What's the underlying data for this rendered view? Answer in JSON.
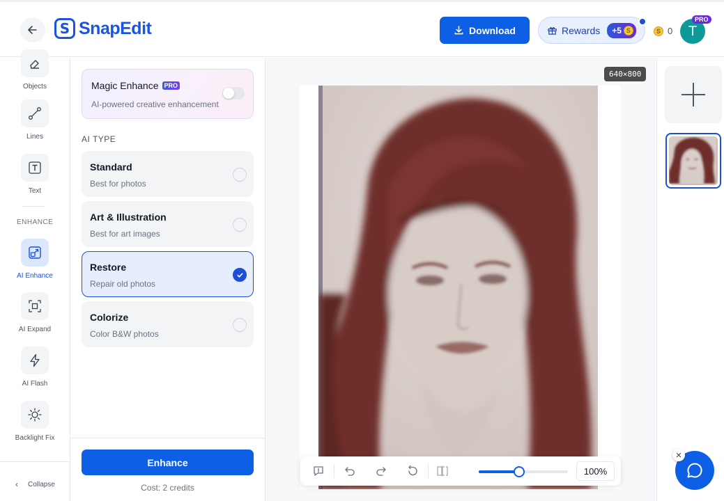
{
  "header": {
    "back_icon": "arrow-left-icon",
    "logo_mark": "S",
    "logo_text": "SnapEdit",
    "download_label": "Download",
    "rewards_label": "Rewards",
    "rewards_bonus": "+5",
    "coin_symbol": "S",
    "credits": "0",
    "avatar_initial": "T",
    "pro_badge": "PRO"
  },
  "sidebar": {
    "items": [
      {
        "label": "Objects",
        "icon": "eraser-icon"
      },
      {
        "label": "Lines",
        "icon": "line-icon"
      },
      {
        "label": "Text",
        "icon": "text-icon"
      },
      {
        "label": "AI Enhance",
        "icon": "enhance-icon"
      },
      {
        "label": "AI Expand",
        "icon": "expand-icon"
      },
      {
        "label": "AI Flash",
        "icon": "flash-icon"
      },
      {
        "label": "Backlight Fix",
        "icon": "sun-icon"
      }
    ],
    "section_label": "ENHANCE",
    "active_item": "AI Enhance",
    "collapse_label": "Collapse"
  },
  "panel": {
    "magic_title": "Magic Enhance",
    "magic_pro": "PRO",
    "magic_subtitle": "AI-powered creative enhancement",
    "magic_enabled": false,
    "ai_type_label": "AI TYPE",
    "options": [
      {
        "title": "Standard",
        "subtitle": "Best for photos",
        "selected": false
      },
      {
        "title": "Art & Illustration",
        "subtitle": "Best for art images",
        "selected": false
      },
      {
        "title": "Restore",
        "subtitle": "Repair old photos",
        "selected": true
      },
      {
        "title": "Colorize",
        "subtitle": "Color B&W photos",
        "selected": false
      }
    ],
    "enhance_label": "Enhance",
    "cost_label": "Cost: 2 credits"
  },
  "canvas": {
    "dimensions": "640×800",
    "zoom_label": "100%",
    "zoom_fraction": 0.45
  },
  "colors": {
    "accent": "#0d5fe6",
    "brand": "#1a56db"
  }
}
